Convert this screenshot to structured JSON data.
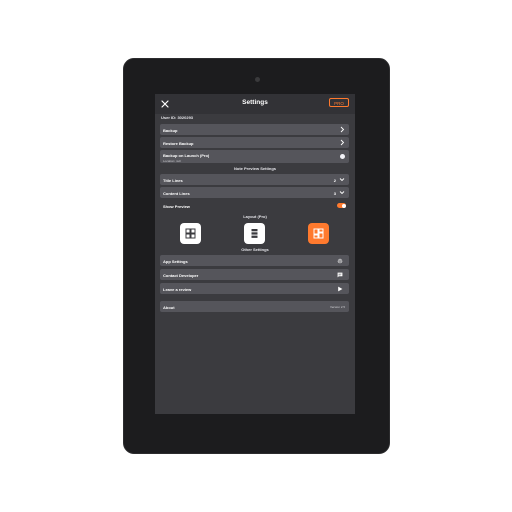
{
  "header": {
    "title": "Settings",
    "pro_label": "PRO"
  },
  "user_id": "User ID: 3020293",
  "backup": {
    "backup_label": "Backup",
    "restore_label": "Restore Backup",
    "launch_label": "Backup on Launch (Pro)",
    "launch_sub": "Location: null"
  },
  "note_preview": {
    "section": "Note Preview Settings",
    "title_lines_label": "Title Lines",
    "title_lines_value": "2",
    "content_lines_label": "Content Lines",
    "content_lines_value": "3",
    "show_preview_label": "Show Preview"
  },
  "layout": {
    "section": "Layout (Pro)"
  },
  "other": {
    "section": "Other Settings",
    "app_settings": "App Settings",
    "contact": "Contact Developer",
    "review": "Leave a review"
  },
  "about": {
    "label": "About",
    "version": "Version 2.5"
  },
  "colors": {
    "accent": "#ff7a2e",
    "row_bg": "#55555b",
    "screen_bg": "#3b3b3f"
  }
}
